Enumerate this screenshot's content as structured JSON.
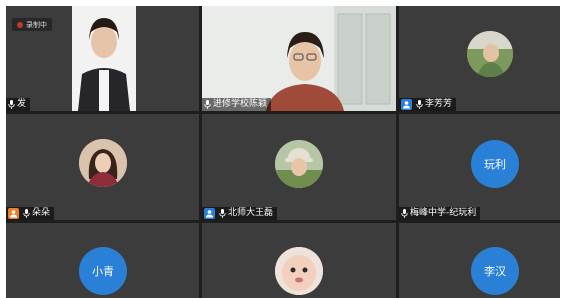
{
  "recording": {
    "label": "录制中"
  },
  "tiles": [
    {
      "name": "发",
      "type": "video"
    },
    {
      "name": "进修学校陈颖",
      "type": "video"
    },
    {
      "name": "李芳芳",
      "type": "photo"
    },
    {
      "name": "朵朵",
      "type": "photo"
    },
    {
      "name": "北师大王磊",
      "type": "photo"
    },
    {
      "name": "梅峰中学-纪玩利",
      "type": "initial",
      "initial": "玩利"
    },
    {
      "name": "",
      "type": "initial",
      "initial": "小青"
    },
    {
      "name": "",
      "type": "photo"
    },
    {
      "name": "",
      "type": "initial",
      "initial": "李汉"
    }
  ],
  "colors": {
    "tile_bg": "#3c3c3c",
    "grid_gap": "#1e1e1e",
    "avatar_blue": "#2a80d6",
    "active_speaker_border": "#8fc74a",
    "badge_blue": "#2a80d6",
    "badge_orange": "#e8802d"
  },
  "icons": {
    "mic": "microphone-icon",
    "recording": "record-dot-icon",
    "participant_badge": "person-badge-icon"
  }
}
